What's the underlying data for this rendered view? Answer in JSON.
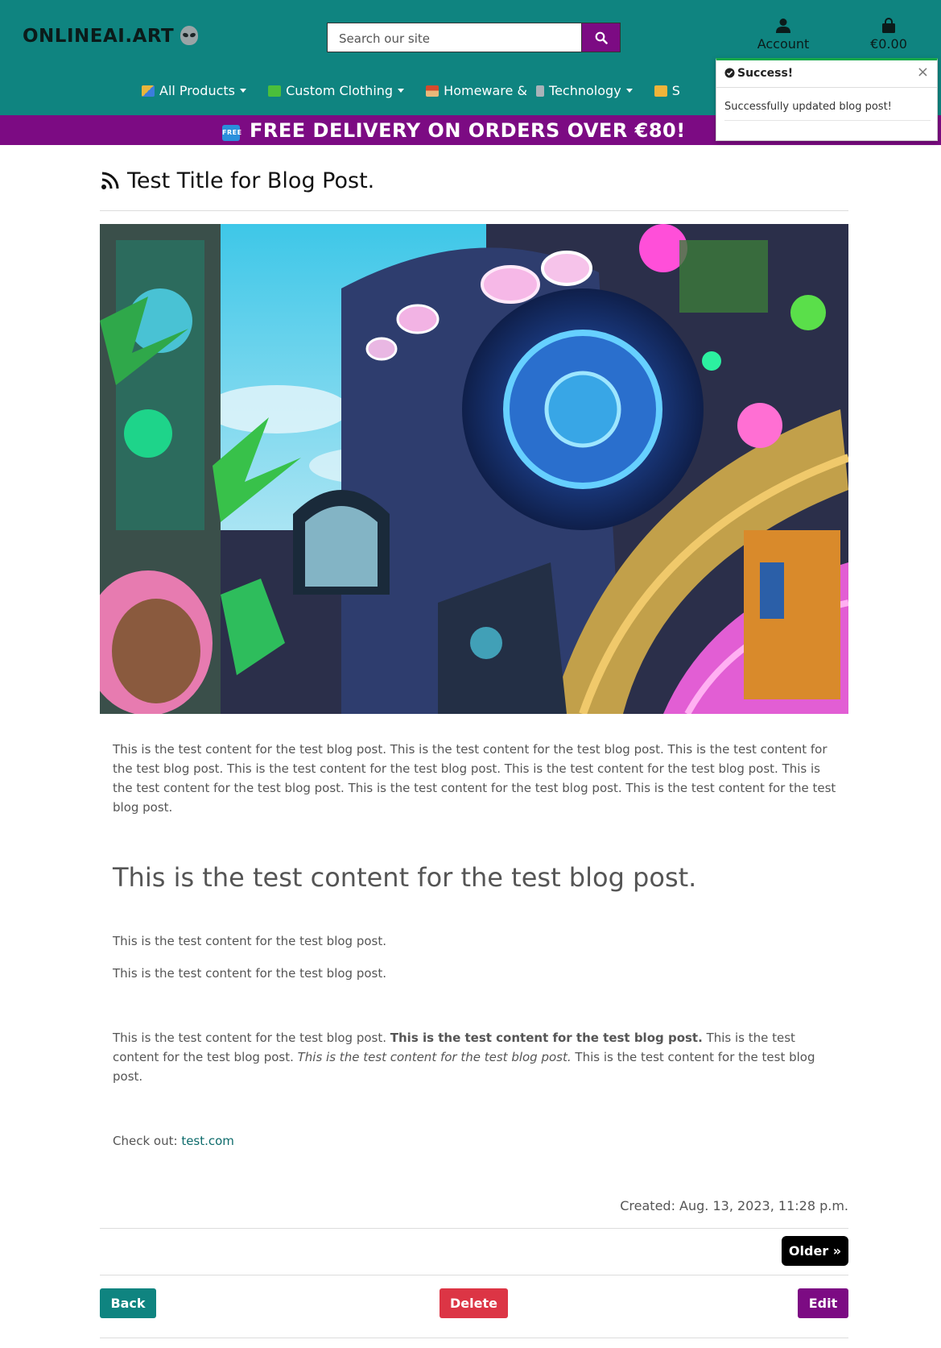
{
  "header": {
    "logo_text": "ONLINEAI.ART",
    "search_placeholder": "Search our site",
    "account_label": "Account",
    "cart_total": "€0.00"
  },
  "nav": {
    "items": [
      {
        "label": "All Products"
      },
      {
        "label": "Custom Clothing"
      },
      {
        "label": "Homeware &"
      },
      {
        "label": "Technology"
      },
      {
        "label": "S"
      }
    ]
  },
  "banner": {
    "badge": "FREE",
    "text": "FREE DELIVERY ON ORDERS OVER €80!"
  },
  "toast": {
    "title": "Success!",
    "message": "Successfully updated blog post!"
  },
  "post": {
    "title": "Test Title for Blog Post.",
    "para1": "This is the test content for the test blog post. This is the test content for the test blog post. This is the test content for the test blog post. This is the test content for the test blog post. This is the test content for the test blog post.  This is the test content for the test blog post. This is the test content for the test blog post. This is the test content for the test blog post.",
    "heading": "This is the test content for the test blog post.",
    "para2": "This is the test content for the test blog post.",
    "para3": "This is the test content for the test blog post.",
    "para4_a": "This is the test content for the test blog post. ",
    "para4_bold": "This is the test content for the test blog post.",
    "para4_b": " This is the test content for the test blog post. ",
    "para4_italic": "This is the test content for the test blog post.",
    "para4_c": " This is the test content for the test blog post.",
    "checkout_label": "Check out: ",
    "checkout_link": "test.com",
    "created": "Created: Aug. 13, 2023, 11:28 p.m."
  },
  "actions": {
    "older": "Older »",
    "back": "Back",
    "delete": "Delete",
    "edit": "Edit"
  },
  "colors": {
    "teal": "#0f8480",
    "purple": "#7c0b83",
    "danger": "#dc3545",
    "success": "#17a84a"
  }
}
